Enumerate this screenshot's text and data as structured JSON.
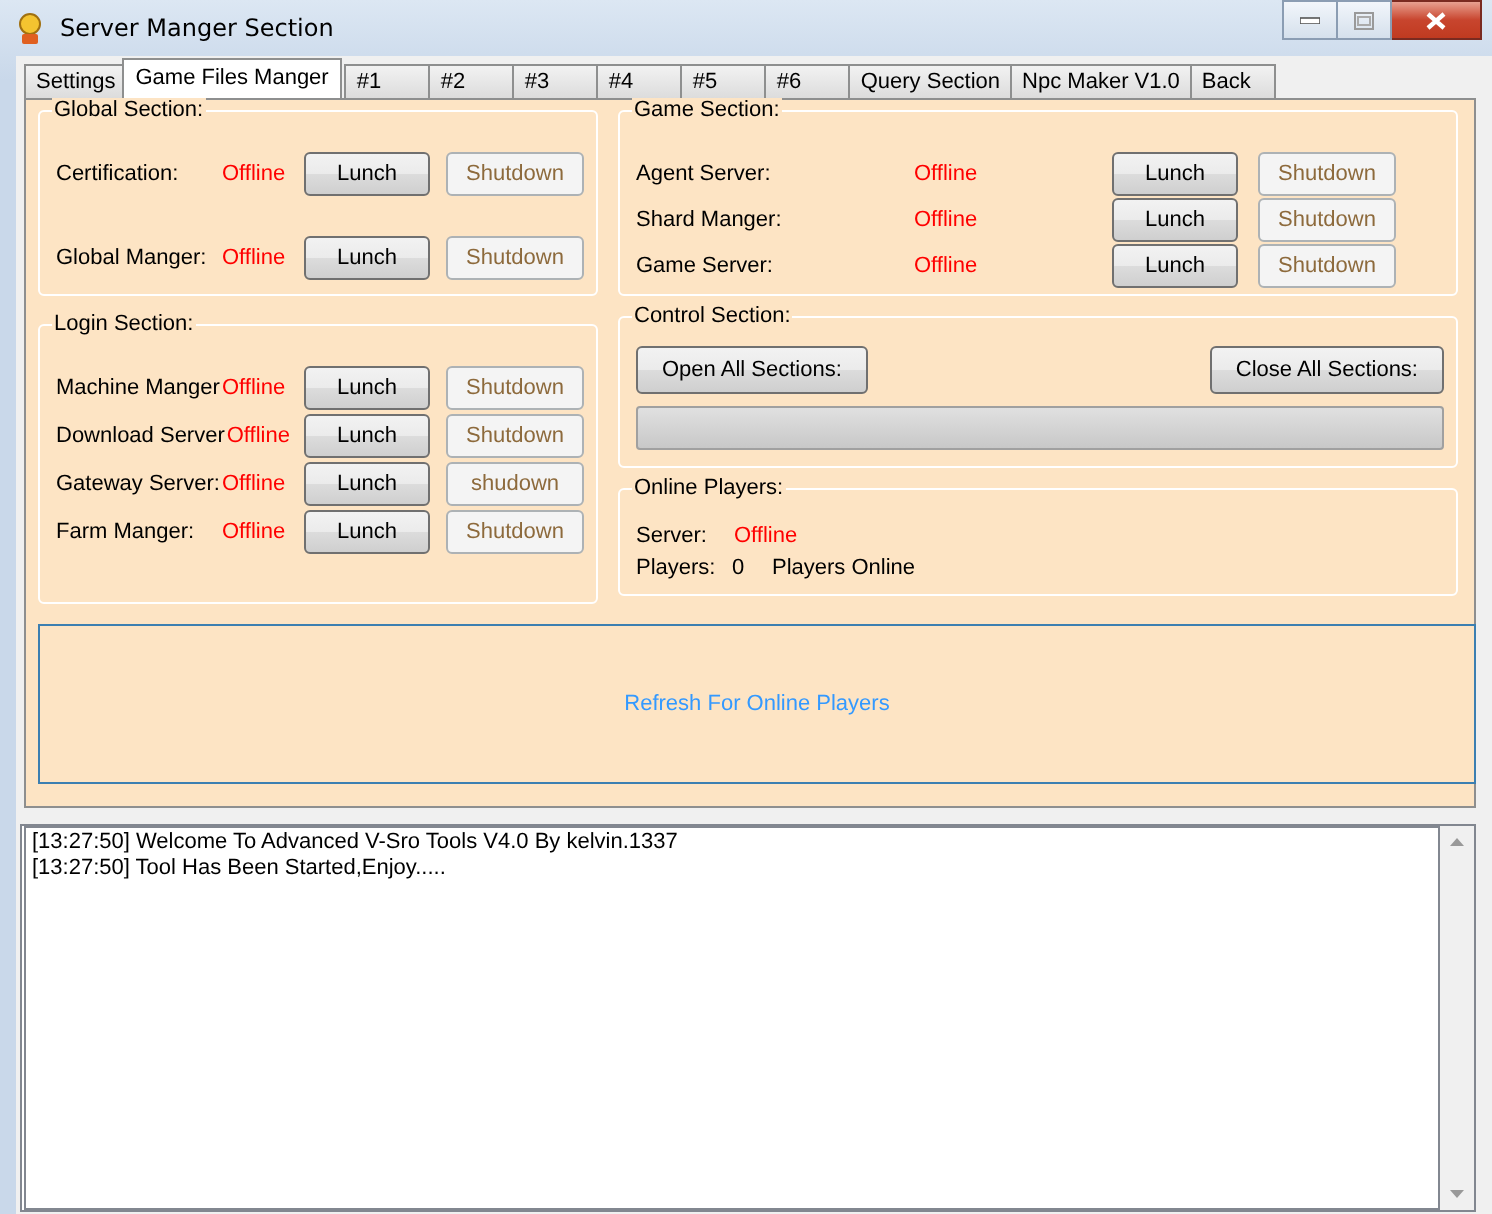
{
  "window": {
    "title": "Server Manger Section"
  },
  "tabs": [
    {
      "label": "Settings",
      "selected": false
    },
    {
      "label": "Game Files Manger",
      "selected": true
    },
    {
      "label": "#1",
      "selected": false
    },
    {
      "label": "#2",
      "selected": false
    },
    {
      "label": "#3",
      "selected": false
    },
    {
      "label": "#4",
      "selected": false
    },
    {
      "label": "#5",
      "selected": false
    },
    {
      "label": "#6",
      "selected": false
    },
    {
      "label": "Query Section",
      "selected": false
    },
    {
      "label": "Npc Maker V1.0",
      "selected": false
    },
    {
      "label": "Back",
      "selected": false
    }
  ],
  "global_section": {
    "title": "Global Section:",
    "servers": [
      {
        "name": "Certification:",
        "status": "Offline",
        "online": false,
        "launch": {
          "label": "Lunch",
          "disabled": false
        },
        "shutdown": {
          "label": "Shutdown",
          "disabled": true
        }
      },
      {
        "name": "Global Manger:",
        "status": "Offline",
        "online": false,
        "launch": {
          "label": "Lunch",
          "disabled": false
        },
        "shutdown": {
          "label": "Shutdown",
          "disabled": true
        }
      }
    ]
  },
  "login_section": {
    "title": "Login Section:",
    "servers": [
      {
        "name": "Machine Manger",
        "status": "Offline",
        "online": false,
        "launch": {
          "label": "Lunch",
          "disabled": false
        },
        "shutdown": {
          "label": "Shutdown",
          "disabled": true
        }
      },
      {
        "name": "Download Server",
        "status": "Offline",
        "online": false,
        "launch": {
          "label": "Lunch",
          "disabled": false
        },
        "shutdown": {
          "label": "Shutdown",
          "disabled": true
        }
      },
      {
        "name": "Gateway Server:",
        "status": "Offline",
        "online": false,
        "launch": {
          "label": "Lunch",
          "disabled": false
        },
        "shutdown": {
          "label": "shudown",
          "disabled": true
        }
      },
      {
        "name": "Farm Manger:",
        "status": "Offline",
        "online": false,
        "launch": {
          "label": "Lunch",
          "disabled": false
        },
        "shutdown": {
          "label": "Shutdown",
          "disabled": true
        }
      }
    ]
  },
  "game_section": {
    "title": "Game Section:",
    "servers": [
      {
        "name": "Agent Server:",
        "status": "Offline",
        "online": false,
        "launch": {
          "label": "Lunch",
          "disabled": false
        },
        "shutdown": {
          "label": "Shutdown",
          "disabled": true
        }
      },
      {
        "name": "Shard Manger:",
        "status": "Offline",
        "online": false,
        "launch": {
          "label": "Lunch",
          "disabled": false
        },
        "shutdown": {
          "label": "Shutdown",
          "disabled": true
        }
      },
      {
        "name": "Game Server:",
        "status": "Offline",
        "online": false,
        "launch": {
          "label": "Lunch",
          "disabled": false
        },
        "shutdown": {
          "label": "Shutdown",
          "disabled": true
        }
      }
    ]
  },
  "control_section": {
    "title": "Control Section:",
    "open_button": "Open All Sections:",
    "close_button": "Close All Sections:",
    "progress": {
      "level": 0
    }
  },
  "online_players": {
    "title": "Online Players:",
    "server_label": "Server:",
    "server_status": "Offline",
    "server_online": false,
    "players_label": "Players:",
    "players_count": "0",
    "players_suffix": "Players Online"
  },
  "refresh_link": "Refresh For Online Players",
  "log": [
    "[13:27:50] Welcome To Advanced V-Sro Tools V4.0 By kelvin.1337",
    "[13:27:50] Tool Has Been Started,Enjoy....."
  ]
}
